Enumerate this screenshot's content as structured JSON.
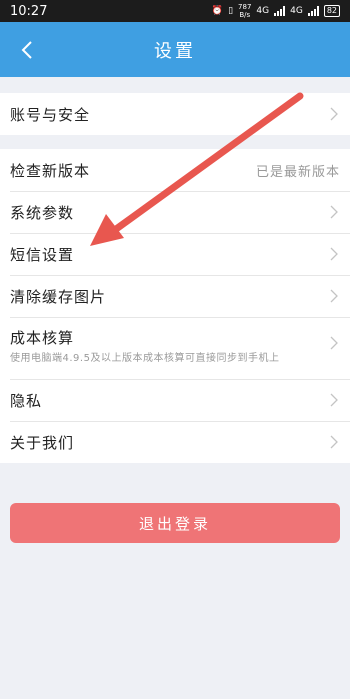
{
  "status_bar": {
    "time": "10:27",
    "speed_top": "787",
    "speed_bottom": "B/s",
    "net_1": "4G",
    "net_2": "4G",
    "battery": "82"
  },
  "nav": {
    "title": "设置",
    "back_icon": "chevron-left-icon",
    "color": "#3f9fe2"
  },
  "settings": {
    "account_security": "账号与安全",
    "check_update": "检查新版本",
    "check_update_value": "已是最新版本",
    "system_params": "系统参数",
    "sms_settings": "短信设置",
    "clear_cache": "清除缓存图片",
    "cost_accounting": "成本核算",
    "cost_accounting_desc": "使用电脑端4.9.5及以上版本成本核算可直接同步到手机上",
    "privacy": "隐私",
    "about_us": "关于我们"
  },
  "logout": {
    "label": "退出登录",
    "color": "#ef7476"
  },
  "annotation": {
    "icon": "red-arrow-icon",
    "color": "#e8574f",
    "points_to": "短信设置"
  }
}
